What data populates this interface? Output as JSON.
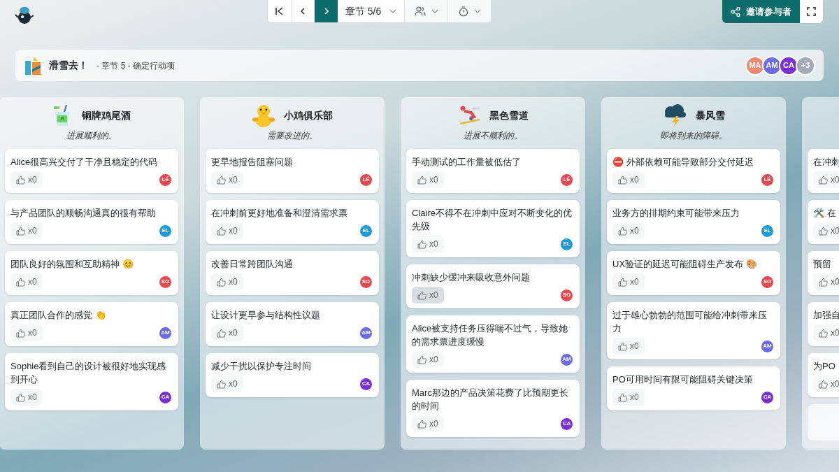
{
  "toolbar": {
    "section": "章节 5/6"
  },
  "invite_button": "邀请参与者",
  "board": {
    "title": "滑雪去！",
    "subtitle": "- 章节 5 - 确定行动项",
    "participants": [
      {
        "initials": "MA",
        "color": "#f0896d"
      },
      {
        "initials": "AM",
        "color": "#6b6be6"
      },
      {
        "initials": "CA",
        "color": "#7b2fd6"
      },
      {
        "initials": "+3",
        "color": "#a3a9b5"
      }
    ]
  },
  "columns": [
    {
      "kind": "cocktail",
      "title": "铜牌鸡尾酒",
      "subtitle": "进展顺利的。",
      "cards": [
        {
          "text": "Alice很高兴交付了干净且稳定的代码",
          "votes": "x0",
          "vote_active": false,
          "author": "LÉ",
          "color": "#e5484d"
        },
        {
          "text": "与产品团队的顺畅沟通真的很有帮助",
          "votes": "x0",
          "vote_active": false,
          "author": "EL",
          "color": "#1e9bd7"
        },
        {
          "text": "团队良好的氛围和互助精神 😊",
          "votes": "x0",
          "vote_active": false,
          "author": "SO",
          "color": "#e5484d"
        },
        {
          "text": "真正团队合作的感觉 👏",
          "votes": "x0",
          "vote_active": false,
          "author": "AM",
          "color": "#6b6be6"
        },
        {
          "text": "Sophie看到自己的设计被很好地实现感到开心",
          "votes": "x0",
          "vote_active": false,
          "author": "CA",
          "color": "#7b2fd6"
        }
      ]
    },
    {
      "kind": "chick",
      "title": "小鸡俱乐部",
      "subtitle": "需要改进的。",
      "cards": [
        {
          "text": "更早地报告阻塞问题",
          "votes": "x0",
          "vote_active": false,
          "author": "LÉ",
          "color": "#e5484d"
        },
        {
          "text": "在冲刺前更好地准备和澄清需求票",
          "votes": "x0",
          "vote_active": false,
          "author": "EL",
          "color": "#1e9bd7"
        },
        {
          "text": "改善日常跨团队沟通",
          "votes": "x0",
          "vote_active": false,
          "author": "SO",
          "color": "#e5484d"
        },
        {
          "text": "让设计更早参与结构性议题",
          "votes": "x0",
          "vote_active": false,
          "author": "AM",
          "color": "#6b6be6"
        },
        {
          "text": "减少干扰以保护专注时间",
          "votes": "x0",
          "vote_active": false,
          "author": "CA",
          "color": "#7b2fd6"
        }
      ]
    },
    {
      "kind": "skier",
      "title": "黑色雪道",
      "subtitle": "进展不顺利的。",
      "cards": [
        {
          "text": "手动测试的工作量被低估了",
          "votes": "x0",
          "vote_active": false,
          "author": "LÉ",
          "color": "#e5484d"
        },
        {
          "text": "Claire不得不在冲刺中应对不断变化的优先级",
          "votes": "x0",
          "vote_active": false,
          "author": "EL",
          "color": "#1e9bd7"
        },
        {
          "text": "冲刺缺少缓冲来吸收意外问题",
          "votes": "x0",
          "vote_active": true,
          "author": "SO",
          "color": "#e5484d"
        },
        {
          "text": "Alice被支持任务压得喘不过气，导致她的需求票进度缓慢",
          "votes": "x0",
          "vote_active": false,
          "author": "AM",
          "color": "#6b6be6"
        },
        {
          "text": "Marc那边的产品决策花费了比预期更长的时间",
          "votes": "x0",
          "vote_active": false,
          "author": "CA",
          "color": "#7b2fd6"
        }
      ]
    },
    {
      "kind": "storm",
      "title": "暴风雪",
      "subtitle": "即将到来的障碍。",
      "cards": [
        {
          "text": "⛔ 外部依赖可能导致部分交付延迟",
          "votes": "x0",
          "vote_active": false,
          "author": "LÉ",
          "color": "#e5484d"
        },
        {
          "text": "业务方的排期约束可能带来压力",
          "votes": "x0",
          "vote_active": false,
          "author": "EL",
          "color": "#1e9bd7"
        },
        {
          "text": "UX验证的延迟可能阻碍生产发布 🎨",
          "votes": "x0",
          "vote_active": false,
          "author": "SO",
          "color": "#e5484d"
        },
        {
          "text": "过于雄心勃勃的范围可能给冲刺带来压力",
          "votes": "x0",
          "vote_active": false,
          "author": "AM",
          "color": "#6b6be6"
        },
        {
          "text": "PO可用时间有限可能阻碍关键决策",
          "votes": "x0",
          "vote_active": false,
          "author": "CA",
          "color": "#7b2fd6"
        }
      ]
    },
    {
      "kind": "partial",
      "cards": [
        {
          "text": "在冲刺",
          "votes": "x0",
          "vote_active": false
        },
        {
          "text": "🛠️ 在",
          "votes": "x0",
          "vote_active": false
        },
        {
          "text": "预留",
          "votes": "x0",
          "vote_active": false
        },
        {
          "text": "加强自",
          "votes": "x0",
          "vote_active": false
        },
        {
          "text": "为PO",
          "votes": "x0",
          "vote_active": false
        }
      ]
    }
  ]
}
